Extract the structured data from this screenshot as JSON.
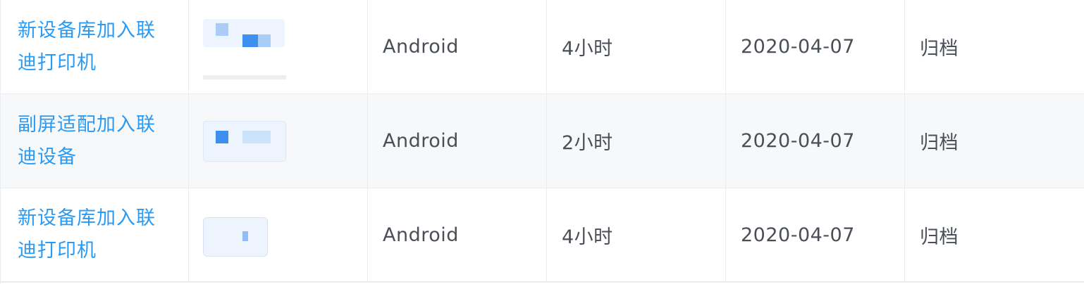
{
  "table": {
    "rows": [
      {
        "name": "新设备库加入联迪打印机",
        "thumbnail_icon": "blurred-screenshot-thumbnail",
        "platform": "Android",
        "duration": "4小时",
        "date": "2020-04-07",
        "status": "归档"
      },
      {
        "name": "副屏适配加入联迪设备",
        "thumbnail_icon": "blurred-screenshot-thumbnail",
        "platform": "Android",
        "duration": "2小时",
        "date": "2020-04-07",
        "status": "归档"
      },
      {
        "name": "新设备库加入联迪打印机",
        "thumbnail_icon": "blurred-screenshot-thumbnail",
        "platform": "Android",
        "duration": "4小时",
        "date": "2020-04-07",
        "status": "归档"
      }
    ]
  },
  "colors": {
    "link": "#2b9af3",
    "text": "#4a4f57",
    "row_alt_background": "#f7f8fa",
    "border": "#e9edf2"
  }
}
